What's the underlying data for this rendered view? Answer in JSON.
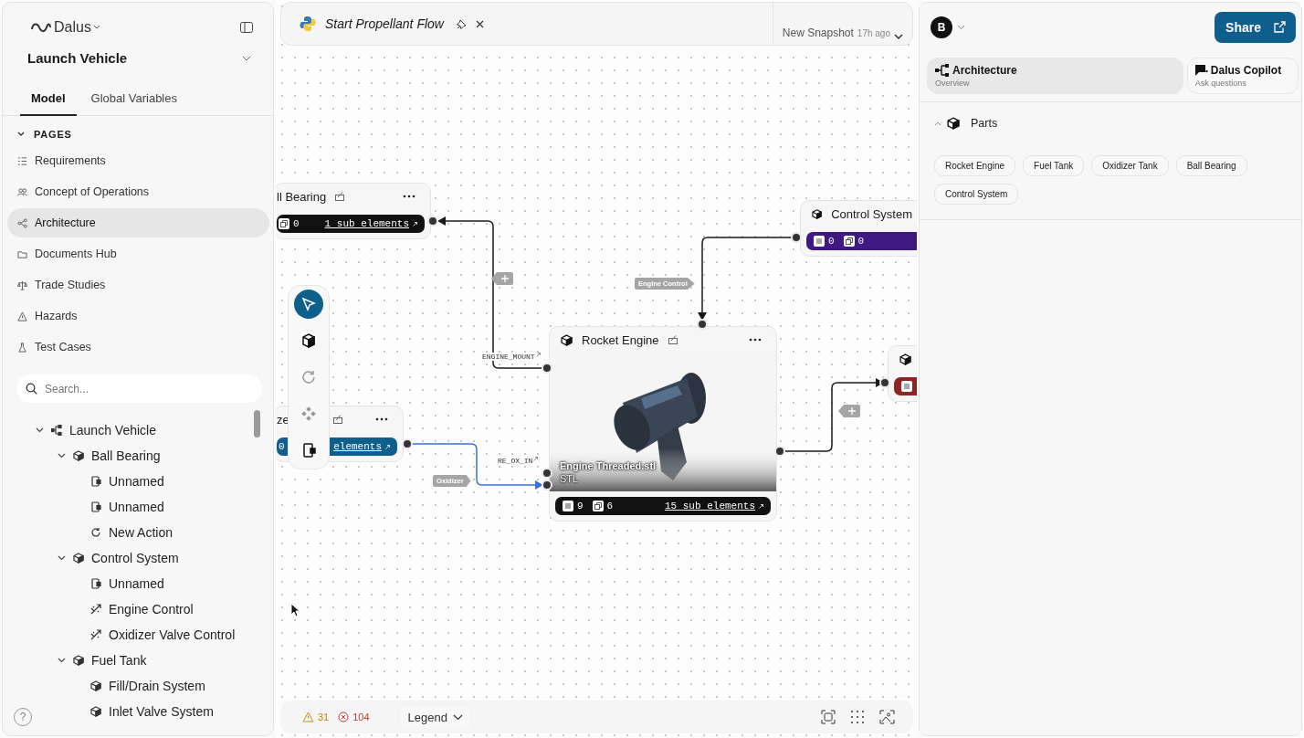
{
  "sidebar": {
    "brand": "Dalus",
    "project": "Launch Vehicle",
    "tabs": [
      {
        "label": "Model",
        "selected": true
      },
      {
        "label": "Global Variables",
        "selected": false
      }
    ],
    "pages_heading": "PAGES",
    "pages_expanded": true,
    "pages": [
      {
        "label": "Requirements",
        "kind": "requirements",
        "selected": false
      },
      {
        "label": "Concept of Operations",
        "kind": "people",
        "selected": false
      },
      {
        "label": "Architecture",
        "kind": "architecture",
        "selected": true
      },
      {
        "label": "Documents Hub",
        "kind": "folder",
        "selected": false
      },
      {
        "label": "Trade Studies",
        "kind": "scale",
        "selected": false
      },
      {
        "label": "Hazards",
        "kind": "hazard",
        "selected": false
      },
      {
        "label": "Test Cases",
        "kind": "flask",
        "selected": false
      }
    ],
    "search": {
      "placeholder": "Search..."
    },
    "help": "?",
    "tree": [
      {
        "label": "Launch Vehicle",
        "kind": "system",
        "expanded": true,
        "children": [
          {
            "label": "Ball Bearing",
            "kind": "part",
            "expanded": true,
            "children": [
              {
                "label": "Unnamed",
                "kind": "port"
              },
              {
                "label": "Unnamed",
                "kind": "port"
              },
              {
                "label": "New Action",
                "kind": "action"
              }
            ]
          },
          {
            "label": "Control System",
            "kind": "part",
            "expanded": true,
            "children": [
              {
                "label": "Unnamed",
                "kind": "port"
              },
              {
                "label": "Engine Control",
                "kind": "interface"
              },
              {
                "label": "Oxidizer Valve Control",
                "kind": "interface"
              }
            ]
          },
          {
            "label": "Fuel Tank",
            "kind": "part",
            "expanded": true,
            "children": [
              {
                "label": "Fill/Drain System",
                "kind": "part"
              },
              {
                "label": "Inlet Valve System",
                "kind": "part"
              }
            ]
          }
        ]
      }
    ]
  },
  "tab": {
    "title": "Start Propellant Flow",
    "snapshot": "New Snapshot",
    "snapshot_age": "17h ago"
  },
  "canvas": {
    "nodes": [
      {
        "title": "ll Bearing",
        "color": "#111111",
        "counts": [
          {
            "kind": "copy",
            "value": "0"
          }
        ],
        "link": "1 sub elements"
      },
      {
        "title": "ze",
        "color": "#0f5f8c",
        "counts": [
          {
            "kind": "plain",
            "value": "0"
          }
        ],
        "link": "elements"
      },
      {
        "title": "Rocket Engine",
        "color": "#111111",
        "counts": [
          {
            "kind": "doc",
            "value": "9"
          },
          {
            "kind": "copy",
            "value": "6"
          }
        ],
        "link": "15 sub elements",
        "file": {
          "name": "Engine Threaded.stl",
          "type": "STL"
        }
      },
      {
        "title": "Control System",
        "color": "#3f1a82",
        "counts": [
          {
            "kind": "doc",
            "value": "0"
          },
          {
            "kind": "copy",
            "value": "0"
          }
        ]
      },
      {
        "color": "#8e2424",
        "counts": [
          {
            "kind": "doc"
          }
        ]
      }
    ],
    "edge_labels": [
      {
        "kind": "mono",
        "text": "ENGINE_MOUNT"
      },
      {
        "kind": "tag",
        "text": "Engine Control"
      },
      {
        "kind": "mono",
        "text": "RE_OX_IN"
      },
      {
        "kind": "tag",
        "text": "Oxidizer"
      },
      {
        "kind": "add"
      },
      {
        "kind": "add"
      }
    ],
    "tools": [
      {
        "kind": "select",
        "selected": true
      },
      {
        "kind": "part",
        "selected": false
      },
      {
        "kind": "action",
        "selected": false
      },
      {
        "kind": "move",
        "selected": false
      },
      {
        "kind": "port",
        "selected": false
      }
    ]
  },
  "status": {
    "warnings": "31",
    "errors": "104",
    "legend": "Legend"
  },
  "panel": {
    "avatar": "B",
    "share": "Share",
    "tabs": [
      {
        "title": "Architecture",
        "subtitle": "Overview",
        "kind": "architecture",
        "selected": true
      },
      {
        "title": "Dalus Copilot",
        "subtitle": "Ask questions",
        "kind": "copilot",
        "selected": false
      }
    ],
    "section": {
      "title": "Parts",
      "expanded": true
    },
    "chips": [
      "Rocket Engine",
      "Fuel Tank",
      "Oxidizer Tank",
      "Ball Bearing",
      "Control System"
    ]
  }
}
